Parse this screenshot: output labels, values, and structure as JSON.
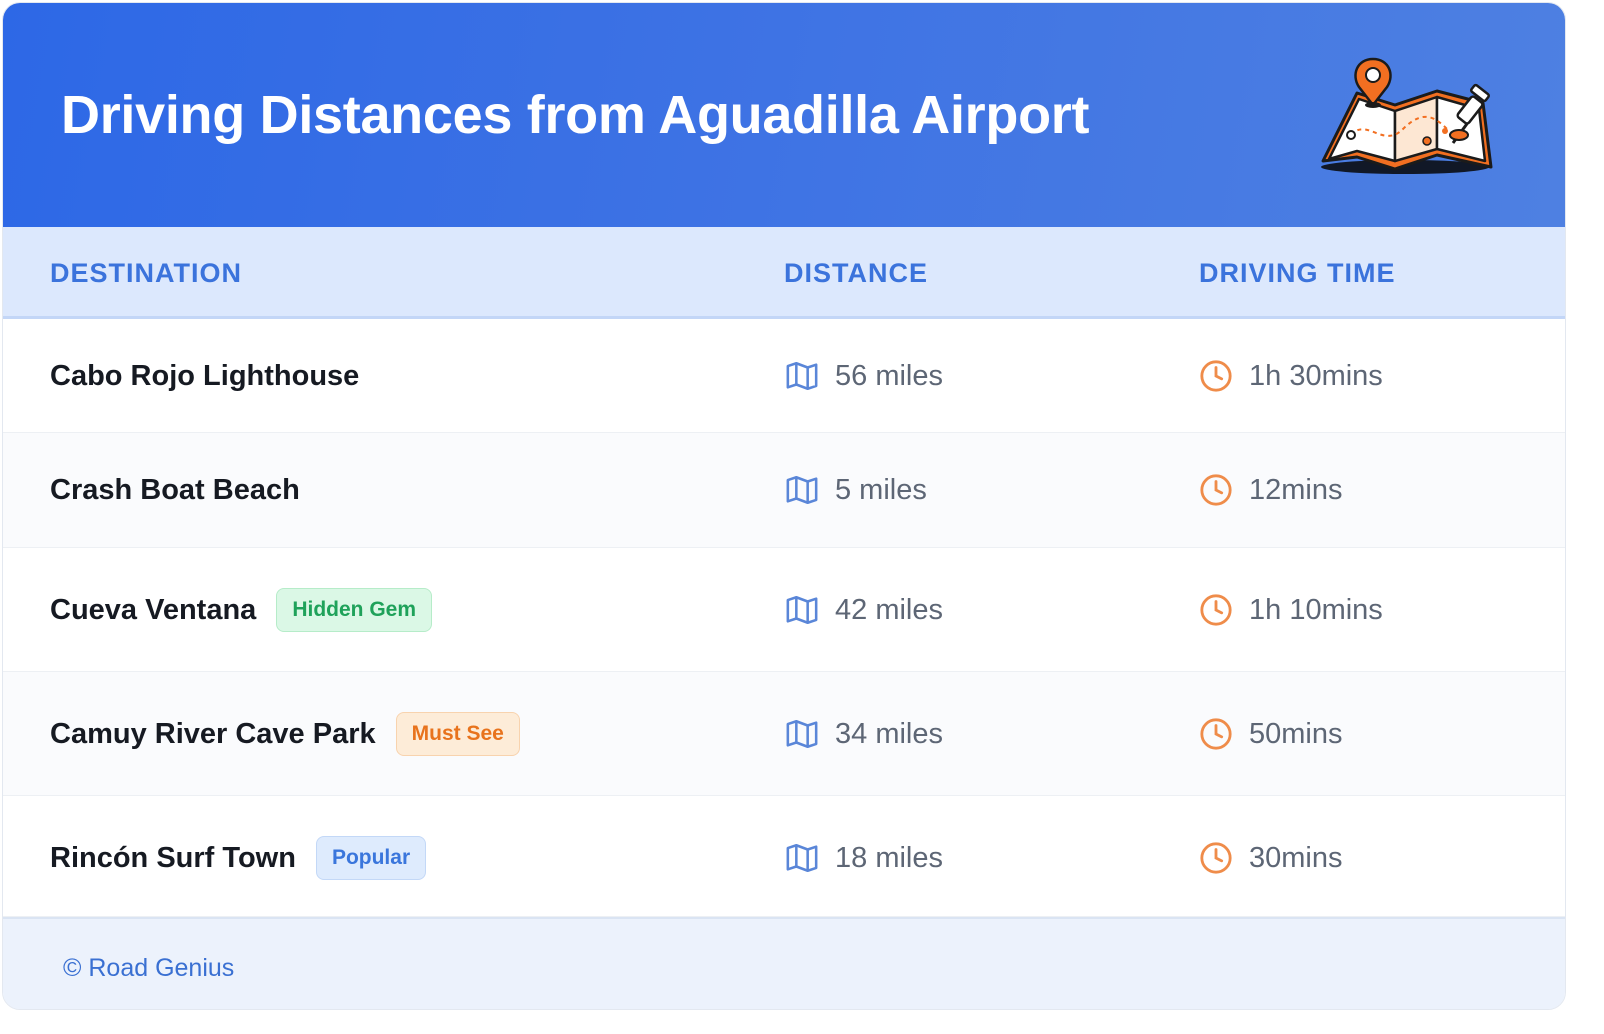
{
  "header": {
    "title": "Driving Distances from Aguadilla Airport",
    "illustration": "map-with-pins-icon"
  },
  "table": {
    "columns": [
      "DESTINATION",
      "DISTANCE",
      "DRIVING TIME"
    ],
    "rows": [
      {
        "destination": "Cabo Rojo Lighthouse",
        "badge": null,
        "distance": "56 miles",
        "time": "1h 30mins"
      },
      {
        "destination": "Crash Boat Beach",
        "badge": null,
        "distance": "5 miles",
        "time": "12mins"
      },
      {
        "destination": "Cueva Ventana",
        "badge": "Hidden Gem",
        "distance": "42 miles",
        "time": "1h 10mins"
      },
      {
        "destination": "Camuy River Cave Park",
        "badge": "Must See",
        "distance": "34 miles",
        "time": "50mins"
      },
      {
        "destination": "Rincón Surf Town",
        "badge": "Popular",
        "distance": "18 miles",
        "time": "30mins"
      }
    ],
    "distance_icon": "map-icon",
    "time_icon": "clock-icon"
  },
  "footer": {
    "credit": "© Road Genius"
  },
  "colors": {
    "header_bg": "#2d68e6",
    "column_header": "#3b73dc",
    "badge_hidden_gem": "#1fa25a",
    "badge_must_see": "#e8731d",
    "badge_popular": "#3a76dc",
    "time_icon": "#ef8c4a",
    "distance_icon": "#5a86d8"
  }
}
